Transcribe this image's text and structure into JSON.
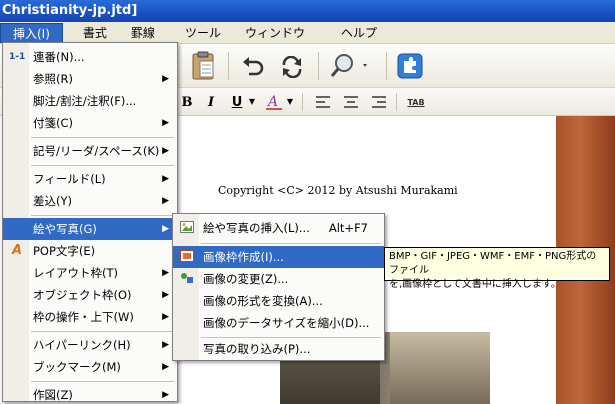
{
  "window": {
    "title": "Christianity-jp.jtd]"
  },
  "menubar": [
    {
      "label": "挿入(I)",
      "active": true
    },
    {
      "label": "書式",
      "active": false
    },
    {
      "label": "罫線",
      "active": false
    },
    {
      "label": "ツール",
      "active": false
    },
    {
      "label": "ウィンドウ",
      "active": false
    },
    {
      "label": "ヘルプ",
      "active": false
    }
  ],
  "toolbar": {
    "tab_label": "TAB",
    "bold": "B",
    "italic": "I",
    "underline": "U",
    "icons": [
      "paste-icon",
      "undo-icon",
      "redo-icon",
      "search-icon",
      "plugin-icon"
    ]
  },
  "document": {
    "copyright": "Copyright <C> 2012 by Atsushi Murakami"
  },
  "insert_menu": {
    "items": [
      {
        "label": "連番(N)...",
        "icon": "1-1",
        "has_sub": false
      },
      {
        "label": "参照(R)",
        "has_sub": true
      },
      {
        "label": "脚注/割注/注釈(F)...",
        "has_sub": false
      },
      {
        "label": "付箋(C)",
        "has_sub": true
      },
      {
        "label": "記号/リーダ/スペース(K)",
        "has_sub": true
      },
      {
        "label": "フィールド(L)",
        "has_sub": true
      },
      {
        "label": "差込(Y)",
        "has_sub": true
      },
      {
        "label": "絵や写真(G)",
        "has_sub": true,
        "highlighted": true
      },
      {
        "label": "POP文字(E)",
        "icon": "A",
        "has_sub": false
      },
      {
        "label": "レイアウト枠(T)",
        "has_sub": true
      },
      {
        "label": "オブジェクト枠(O)",
        "has_sub": true
      },
      {
        "label": "枠の操作・上下(W)",
        "has_sub": true
      },
      {
        "label": "ハイパーリンク(H)",
        "has_sub": true
      },
      {
        "label": "ブックマーク(M)",
        "has_sub": true
      },
      {
        "label": "作図(Z)",
        "has_sub": true
      }
    ]
  },
  "picture_submenu": {
    "items": [
      {
        "label": "絵や写真の挿入(L)...",
        "shortcut": "Alt+F7"
      },
      {
        "label": "画像枠作成(I)...",
        "highlighted": true
      },
      {
        "label": "画像の変更(Z)..."
      },
      {
        "label": "画像の形式を変換(A)..."
      },
      {
        "label": "画像のデータサイズを縮小(D)..."
      },
      {
        "label": "写真の取り込み(P)..."
      }
    ]
  },
  "tooltip": {
    "line1": "BMP・GIF・JPEG・WMF・EMF・PNG形式のファイル",
    "line2": "を,画像枠として文書中に挿入します。"
  },
  "colors": {
    "highlight": "#316ac5",
    "titlebar": "#1a51c4",
    "tooltip_bg": "#ffffe1"
  }
}
